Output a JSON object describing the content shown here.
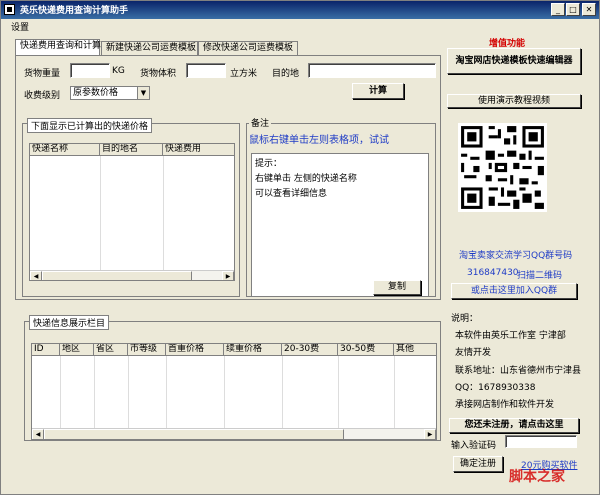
{
  "window": {
    "title": "英乐快递费用查询计算助手",
    "min": "_",
    "max": "□",
    "close": "✕"
  },
  "menu": {
    "settings": "设置"
  },
  "tabs": [
    "快递费用查询和计算",
    "新建快递公司运费模板",
    "修改快递公司运费模板"
  ],
  "form": {
    "weight_label": "货物重量",
    "weight_value": "",
    "weight_unit": "KG",
    "volume_label": "货物体积",
    "volume_value": "",
    "volume_unit": "立方米",
    "dest_label": "目的地",
    "dest_value": "",
    "level_label": "收费级别",
    "level_value": "原参数价格",
    "calc_button": "计算"
  },
  "results": {
    "title": "下面显示已计算出的快递价格",
    "columns": [
      "快递名称",
      "目的地名",
      "快递费用"
    ]
  },
  "notes": {
    "title": "备注",
    "hint": "鼠标右键单击左则表格项，试试",
    "lines": [
      "提示：",
      "右键单击  左侧的快递名称",
      "可以查看详细信息"
    ],
    "copy_button": "复制"
  },
  "info": {
    "title": "快递信息展示栏目",
    "columns": [
      "ID",
      "地区",
      "省区",
      "市等级",
      "首重价格",
      "续重价格",
      "20-30费",
      "30-50费",
      "其他"
    ]
  },
  "side": {
    "addon_title": "增值功能",
    "editor_button": "淘宝网店快递模板快速编辑器",
    "video_button": "使用演示教程视频",
    "qq_group_label": "淘宝卖家交流学习QQ群号码",
    "qq_group_number": "316847430",
    "scan_label": "扫描二维码",
    "join_button": "或点击这里加入QQ群",
    "desc_title": "说明：",
    "desc_lines": [
      "本软件由英乐工作室 宁津部",
      "友情开发",
      "联系地址：山东省德州市宁津县",
      "QQ：1678930338",
      "承接网店制作和软件开发"
    ],
    "register_button": "您还未注册，请点击这里",
    "code_label": "输入验证码",
    "code_value": "",
    "confirm_button": "确定注册",
    "buy_link": "20元购买软件",
    "watermark": "脚本之家"
  }
}
